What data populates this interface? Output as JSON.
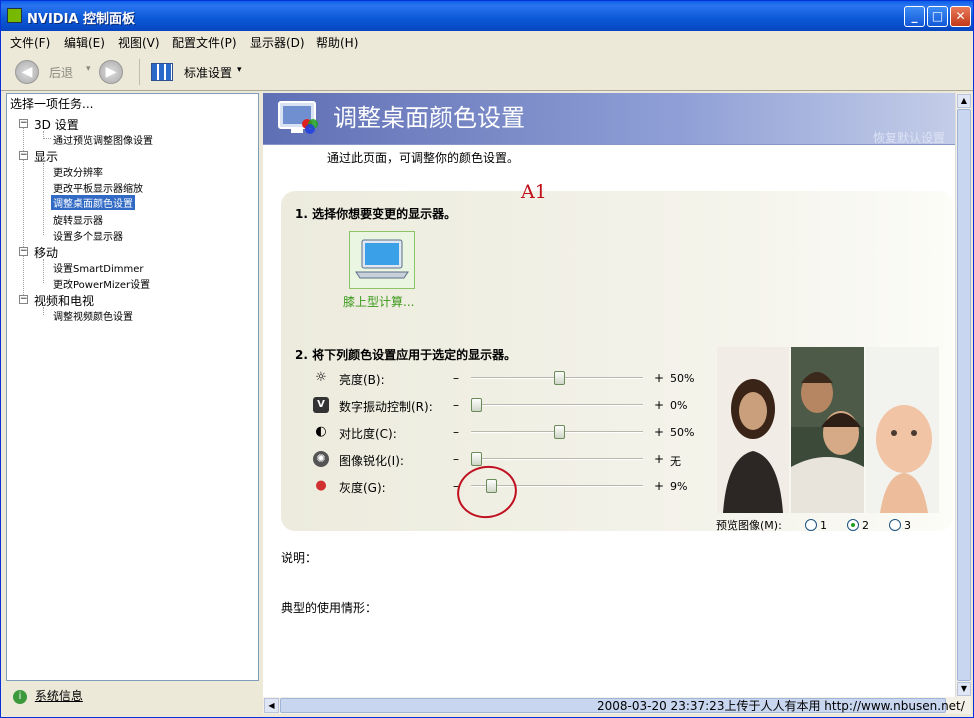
{
  "window": {
    "title": "NVIDIA 控制面板"
  },
  "menu": [
    "文件(F)",
    "编辑(E)",
    "视图(V)",
    "配置文件(P)",
    "显示器(D)",
    "帮助(H)"
  ],
  "toolbar": {
    "back": "后退",
    "view": "标准设置"
  },
  "left": {
    "header": "选择一项任务...",
    "groups": [
      {
        "label": "3D 设置",
        "items": [
          "通过预览调整图像设置"
        ]
      },
      {
        "label": "显示",
        "items": [
          "更改分辨率",
          "更改平板显示器缩放",
          "调整桌面颜色设置",
          "旋转显示器",
          "设置多个显示器"
        ]
      },
      {
        "label": "移动",
        "items": [
          "设置SmartDimmer",
          "更改PowerMizer设置"
        ]
      },
      {
        "label": "视频和电视",
        "items": [
          "调整视频颜色设置"
        ]
      }
    ],
    "selected": "调整桌面颜色设置",
    "sysinfo": "系统信息"
  },
  "page": {
    "title": "调整桌面颜色设置",
    "restore": "恢复默认设置",
    "subtitle": "通过此页面，可调整你的颜色设置。",
    "annotation": "A1",
    "step1": "1. 选择你想要变更的显示器。",
    "display_label": "膝上型计算...",
    "step2": "2. 将下列颜色设置应用于选定的显示器。",
    "sliders": [
      {
        "label": "亮度(B):",
        "minus": "–",
        "plus": "+",
        "value": "50%",
        "level": 0.5,
        "icon": "brightness-icon"
      },
      {
        "label": "数字振动控制(R):",
        "minus": "–",
        "plus": "+",
        "value": "0%",
        "level": 0.0,
        "icon": "vibrance-icon"
      },
      {
        "label": "对比度(C):",
        "minus": "–",
        "plus": "+",
        "value": "50%",
        "level": 0.5,
        "icon": "contrast-icon"
      },
      {
        "label": "图像锐化(I):",
        "minus": "–",
        "plus": "+",
        "value": "无",
        "level": 0.0,
        "icon": "sharpen-icon"
      },
      {
        "label": "灰度(G):",
        "minus": "–",
        "plus": "+",
        "value": "9%",
        "level": 0.09,
        "icon": "gamma-icon"
      }
    ],
    "preview_label": "预览图像(M):",
    "preview_options": [
      "1",
      "2",
      "3"
    ],
    "preview_selected": 1,
    "desc": "说明：",
    "usage": "典型的使用情形："
  },
  "watermark": "2008-03-20 23:37:23上传于人人有本用  http://www.nbusen.net/"
}
